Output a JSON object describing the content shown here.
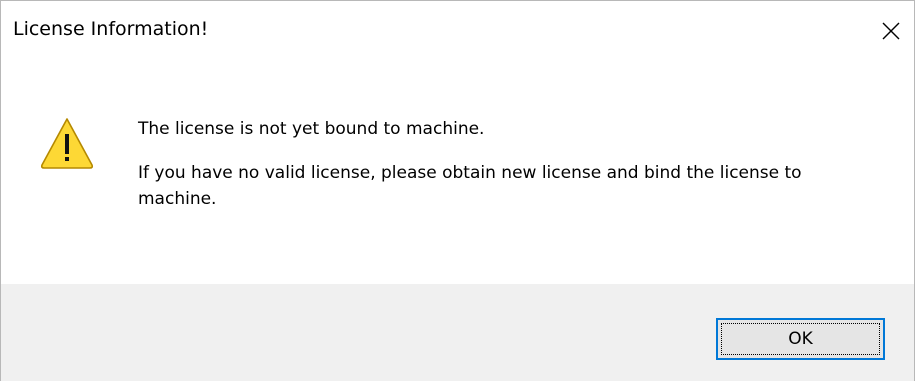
{
  "window": {
    "title": "License Information!",
    "close_icon": "close-icon"
  },
  "message": {
    "icon": "warning-icon",
    "line1": "The license is not yet bound to machine.",
    "line2": "If you have no valid license, please obtain new license and bind the license to machine."
  },
  "buttons": {
    "ok_label": "OK"
  },
  "colors": {
    "dialog_background": "#ffffff",
    "footer_background": "#f0f0f0",
    "button_background": "#e5e5e5",
    "button_focus_border": "#0078d7",
    "warning_fill": "#fdd835",
    "warning_stroke": "#b58900"
  }
}
